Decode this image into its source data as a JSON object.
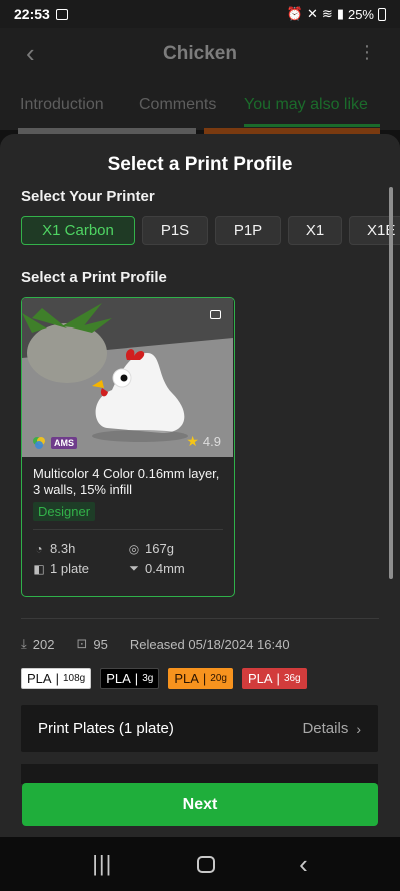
{
  "status_bar": {
    "time": "22:53",
    "battery": "25%"
  },
  "app_bar": {
    "title": "Chicken"
  },
  "tabs": [
    {
      "label": "Introduction",
      "active": false
    },
    {
      "label": "Comments",
      "active": false
    },
    {
      "label": "You may also like",
      "active": true
    }
  ],
  "sheet": {
    "title": "Select a Print Profile",
    "printer_label": "Select Your Printer",
    "printers": [
      "X1 Carbon",
      "P1S",
      "P1P",
      "X1",
      "X1E"
    ],
    "selected_printer": "X1 Carbon",
    "profile_label": "Select a Print Profile"
  },
  "profile_card": {
    "ams_label": "AMS",
    "rating": "4.9",
    "title": "Multicolor 4 Color 0.16mm layer, 3 walls, 15% infill",
    "badge": "Designer",
    "print_time": "8.3h",
    "weight": "167g",
    "plates": "1 plate",
    "nozzle": "0.4mm"
  },
  "meta": {
    "downloads": "202",
    "prints": "95",
    "released": "Released 05/18/2024 16:40"
  },
  "filaments": [
    {
      "type": "PLA",
      "amount": "108g",
      "bg": "#ffffff",
      "fg": "#111111"
    },
    {
      "type": "PLA",
      "amount": "3g",
      "bg": "#000000",
      "fg": "#ffffff"
    },
    {
      "type": "PLA",
      "amount": "20g",
      "bg": "#f7931e",
      "fg": "#2a1300"
    },
    {
      "type": "PLA",
      "amount": "36g",
      "bg": "#d23c3c",
      "fg": "#ffffff"
    }
  ],
  "plates_row": {
    "label": "Print Plates (1 plate)",
    "details": "Details"
  },
  "next_button": "Next",
  "colors": {
    "accent": "#1fae3b",
    "sheet_bg": "#272727"
  }
}
